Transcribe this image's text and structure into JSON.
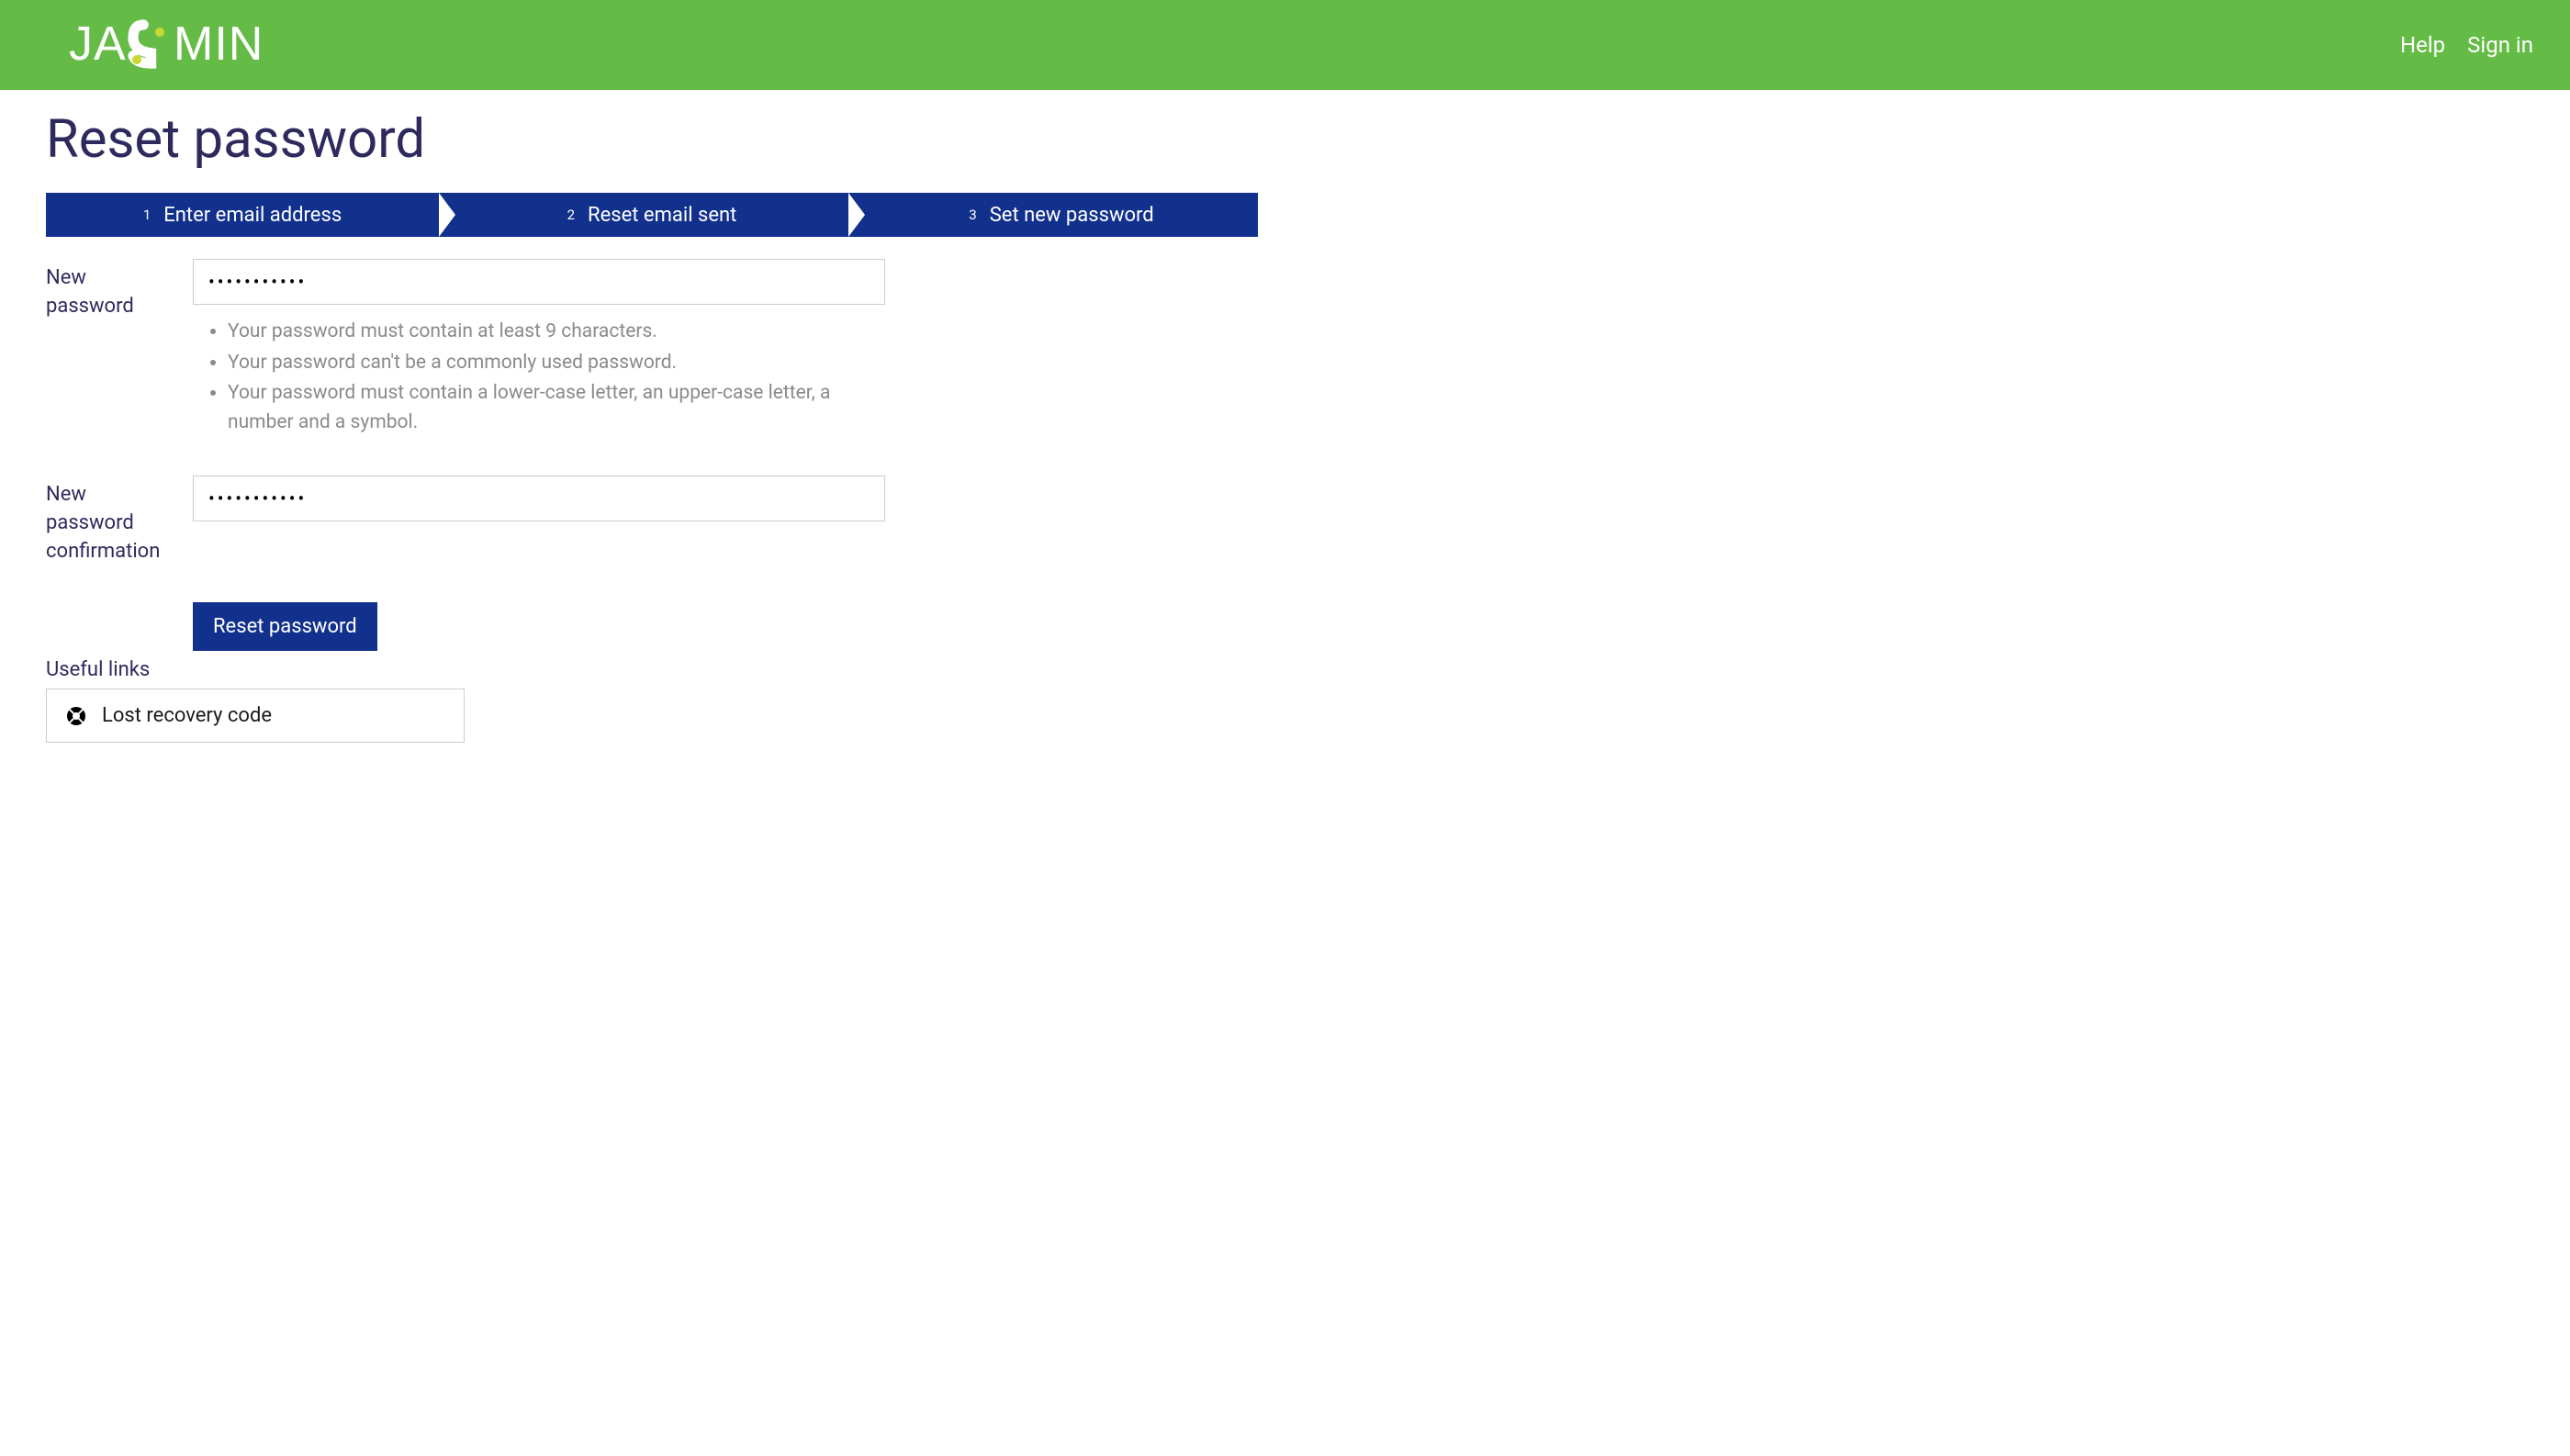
{
  "header": {
    "logo_text": "JASMIN",
    "nav": {
      "help": "Help",
      "signin": "Sign in"
    }
  },
  "page": {
    "title": "Reset password"
  },
  "steps": [
    {
      "num": "1",
      "label": "Enter email address"
    },
    {
      "num": "2",
      "label": "Reset email sent"
    },
    {
      "num": "3",
      "label": "Set new password"
    }
  ],
  "form": {
    "new_password_label": "New password",
    "new_password_value": "•••••••••••",
    "new_password_confirm_label": "New password confirmation",
    "new_password_confirm_value": "•••••••••••",
    "hints": [
      "Your password must contain at least 9 characters.",
      "Your password can't be a commonly used password.",
      "Your password must contain a lower-case letter, an upper-case letter, a number and a symbol."
    ],
    "submit_label": "Reset password"
  },
  "useful_links": {
    "heading": "Useful links",
    "items": [
      {
        "label": "Lost recovery code"
      }
    ]
  }
}
